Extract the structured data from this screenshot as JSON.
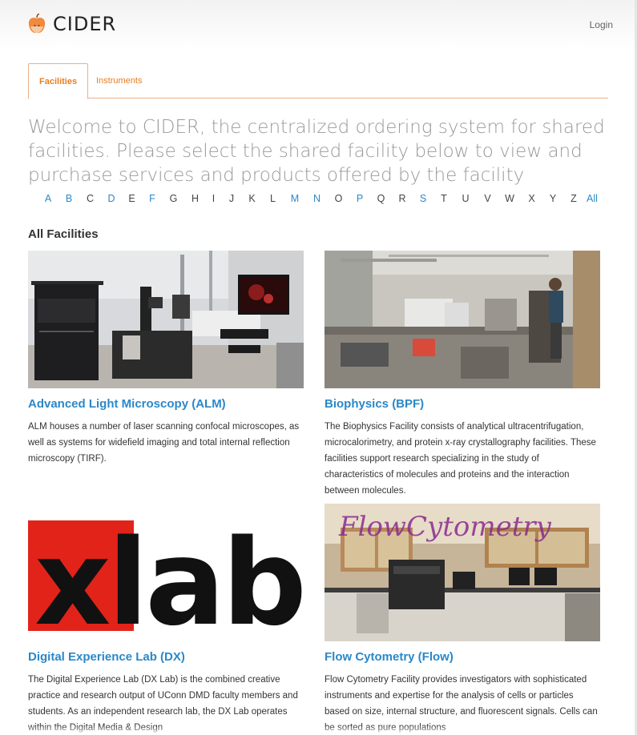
{
  "header": {
    "app_name": "CIDER",
    "login_label": "Login"
  },
  "tabs": [
    {
      "label": "Facilities",
      "active": true
    },
    {
      "label": "Instruments",
      "active": false
    }
  ],
  "welcome_text": "Welcome to CIDER, the centralized ordering system for shared facilities. Please select the shared facility below to view and purchase services and products offered by the facility",
  "alphabet": [
    {
      "letter": "A",
      "link": true
    },
    {
      "letter": "B",
      "link": true
    },
    {
      "letter": "C",
      "link": false
    },
    {
      "letter": "D",
      "link": true
    },
    {
      "letter": "E",
      "link": false
    },
    {
      "letter": "F",
      "link": true
    },
    {
      "letter": "G",
      "link": false
    },
    {
      "letter": "H",
      "link": false
    },
    {
      "letter": "I",
      "link": false
    },
    {
      "letter": "J",
      "link": false
    },
    {
      "letter": "K",
      "link": false
    },
    {
      "letter": "L",
      "link": false
    },
    {
      "letter": "M",
      "link": true
    },
    {
      "letter": "N",
      "link": true
    },
    {
      "letter": "O",
      "link": false
    },
    {
      "letter": "P",
      "link": true
    },
    {
      "letter": "Q",
      "link": false
    },
    {
      "letter": "R",
      "link": false
    },
    {
      "letter": "S",
      "link": true
    },
    {
      "letter": "T",
      "link": false
    },
    {
      "letter": "U",
      "link": false
    },
    {
      "letter": "V",
      "link": false
    },
    {
      "letter": "W",
      "link": false
    },
    {
      "letter": "X",
      "link": false
    },
    {
      "letter": "Y",
      "link": false
    },
    {
      "letter": "Z",
      "link": false
    },
    {
      "letter": "All",
      "link": true
    }
  ],
  "section_title": "All Facilities",
  "facilities": [
    {
      "title": "Advanced Light Microscopy (ALM)",
      "description": "ALM houses a number of laser scanning confocal microscopes, as well as systems for widefield imaging and total internal reflection microscopy (TIRF).",
      "image": "microscope-lab-photo"
    },
    {
      "title": "Biophysics (BPF)",
      "description": "The Biophysics Facility consists of analytical ultracentrifugation, microcalorimetry, and protein x-ray crystallography facilities. These facilities support research specializing in the study of characteristics of molecules and proteins and the interaction between molecules.",
      "image": "biophysics-lab-photo"
    },
    {
      "title": "Digital Experience Lab (DX)",
      "description": "The Digital Experience Lab (DX Lab) is the combined creative practice and research output of UConn DMD faculty members and students. As an independent research lab, the DX Lab operates within the Digital Media & Design",
      "image": "xlab-logo",
      "logo_text": "xlab"
    },
    {
      "title": "Flow Cytometry (Flow)",
      "description": "Flow Cytometry Facility provides investigators with sophisticated instruments and expertise for the analysis of cells or particles based on size, internal structure, and fluorescent signals.  Cells can be sorted as pure populations",
      "image": "flow-cytometry-lab-photo",
      "overlay_text": "FlowCytometry"
    }
  ],
  "colors": {
    "accent": "#e67e22",
    "link": "#2a88c9",
    "xlab_red": "#e2231a"
  }
}
